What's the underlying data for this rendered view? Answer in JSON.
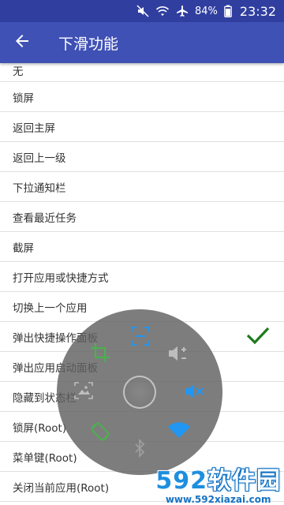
{
  "status_bar": {
    "battery": "84%",
    "time": "23:32",
    "icons": [
      "mute-icon",
      "wifi-icon",
      "airplane-icon",
      "battery-icon"
    ]
  },
  "app_bar": {
    "title": "下滑功能",
    "back_icon": "arrow-back-icon"
  },
  "list": {
    "items": [
      {
        "label": "无"
      },
      {
        "label": "锁屏"
      },
      {
        "label": "返回主屏"
      },
      {
        "label": "返回上一级"
      },
      {
        "label": "下拉通知栏"
      },
      {
        "label": "查看最近任务"
      },
      {
        "label": "截屏"
      },
      {
        "label": "打开应用或快捷方式"
      },
      {
        "label": "切换上一个应用"
      },
      {
        "label": "弹出快捷操作面板",
        "selected": true
      },
      {
        "label": "弹出应用启动面板"
      },
      {
        "label": "隐藏到状态栏"
      },
      {
        "label": "锁屏(Root)"
      },
      {
        "label": "菜单键(Root)"
      },
      {
        "label": "关闭当前应用(Root)"
      }
    ]
  },
  "floating_panel": {
    "icons": [
      "screenshot-icon",
      "volume-adjust-icon",
      "mute-icon",
      "wifi-icon",
      "bluetooth-icon",
      "rotation-icon",
      "image-icon",
      "crop-icon"
    ],
    "accent_colors": {
      "green": "#4caf50",
      "blue": "#2196f3",
      "gray": "#9e9e9e"
    }
  },
  "watermark": {
    "brand_number": "592",
    "brand_text": "软件园",
    "url": "www.592xiazai.com"
  },
  "colors": {
    "primary": "#3f51b5",
    "primary_dark": "#303f9f",
    "check": "#1b7a1b"
  }
}
